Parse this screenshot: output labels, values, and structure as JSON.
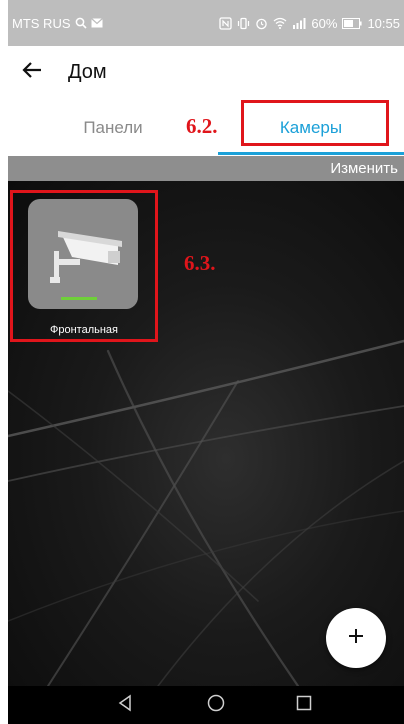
{
  "status_bar": {
    "carrier": "MTS RUS",
    "battery": "60%",
    "time": "10:55"
  },
  "app_bar": {
    "title": "Дом"
  },
  "tabs": [
    {
      "label": "Панели",
      "selected": false
    },
    {
      "label": "Камеры",
      "selected": true
    }
  ],
  "edit_label": "Изменить",
  "cameras": [
    {
      "name": "Фронтальная",
      "status_color": "#6fd03a"
    }
  ],
  "annotations": {
    "tab_label": "6.2.",
    "camera_label": "6.3."
  },
  "colors": {
    "accent": "#1ba0d8",
    "annotation": "#e0151b",
    "status_ok": "#6fd03a"
  },
  "icons": {
    "back": "arrow-left-icon",
    "fab": "plus-icon",
    "nav": [
      "back-triangle-icon",
      "home-circle-icon",
      "recents-square-icon"
    ]
  }
}
